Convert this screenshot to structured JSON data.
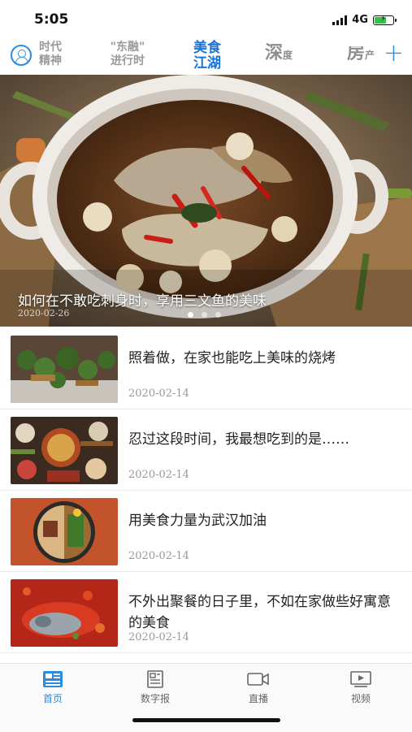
{
  "status_bar": {
    "time": "5:05",
    "network": "4G"
  },
  "channels": [
    {
      "line1": "时代",
      "line2": "精神"
    },
    {
      "line1": "\"东融\"",
      "line2": "进行时"
    },
    {
      "line1": "美食",
      "line2": "江湖"
    },
    {
      "main": "深",
      "small": "度"
    },
    {
      "main": "房",
      "small": "产"
    }
  ],
  "hero": {
    "title": "如何在不敢吃刺身时，享用三文鱼的美味",
    "date": "2020-02-26",
    "pages": 3,
    "active_page": 1
  },
  "news": [
    {
      "title": "照着做，在家也能吃上美味的烧烤",
      "date": "2020-02-14",
      "thumb": "bbq-broccoli-photo"
    },
    {
      "title": "忍过这段时间，我最想吃到的是……",
      "date": "2020-02-14",
      "thumb": "hotpot-spread-photo"
    },
    {
      "title": "用美食力量为武汉加油",
      "date": "2020-02-14",
      "thumb": "noodle-bowl-photo"
    },
    {
      "title": "不外出聚餐的日子里，不如在家做些好寓意的美食",
      "date": "2020-02-14",
      "thumb": "chili-fish-photo"
    }
  ],
  "bottom_nav": [
    {
      "label": "首页",
      "icon": "news-icon",
      "active": true
    },
    {
      "label": "数字报",
      "icon": "newspaper-icon",
      "active": false
    },
    {
      "label": "直播",
      "icon": "video-camera-icon",
      "active": false
    },
    {
      "label": "视频",
      "icon": "play-screen-icon",
      "active": false
    }
  ],
  "colors": {
    "accent": "#2a8be0",
    "active_tab": "#1a73d8",
    "inactive_tab": "#9a9a9a",
    "date": "#999999"
  }
}
